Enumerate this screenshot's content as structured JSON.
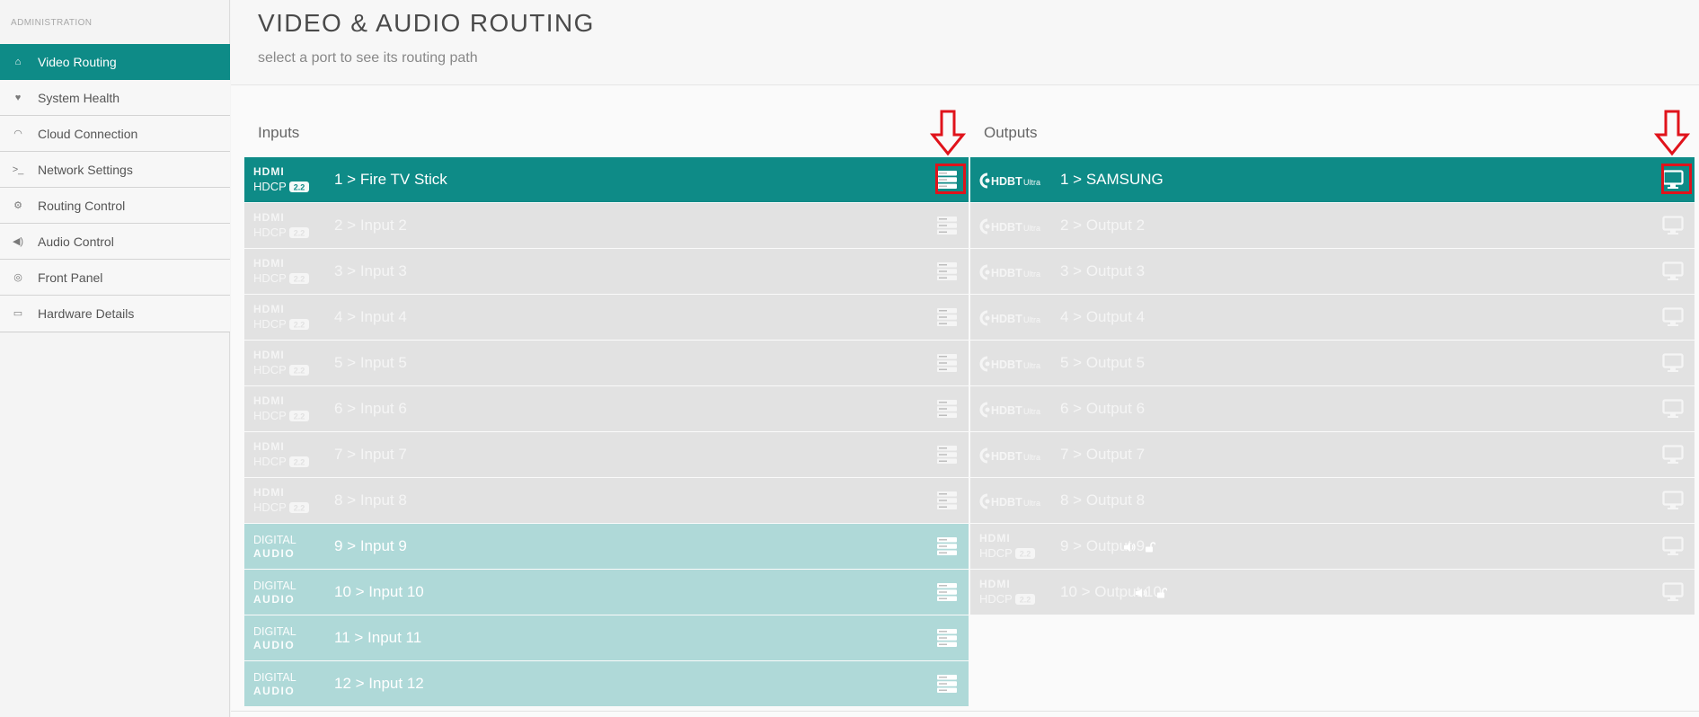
{
  "sidebar": {
    "header": "ADMINISTRATION",
    "items": [
      {
        "label": "Video Routing",
        "icon": "home-icon",
        "glyph": "⌂"
      },
      {
        "label": "System Health",
        "icon": "heart-icon",
        "glyph": "♥"
      },
      {
        "label": "Cloud Connection",
        "icon": "rss-icon",
        "glyph": "◠"
      },
      {
        "label": "Network Settings",
        "icon": "terminal-icon",
        "glyph": ">_"
      },
      {
        "label": "Routing Control",
        "icon": "gears-icon",
        "glyph": "⚙"
      },
      {
        "label": "Audio Control",
        "icon": "speaker-icon",
        "glyph": "◀)"
      },
      {
        "label": "Front Panel",
        "icon": "target-icon",
        "glyph": "◎"
      },
      {
        "label": "Hardware Details",
        "icon": "drive-icon",
        "glyph": "▭"
      }
    ]
  },
  "page": {
    "title": "VIDEO & AUDIO ROUTING",
    "subtitle": "select a port to see its routing path"
  },
  "inputs": {
    "heading": "Inputs",
    "ports": [
      {
        "label": "1 > Fire TV Stick",
        "type": "hdmi"
      },
      {
        "label": "2 > Input 2",
        "type": "hdmi"
      },
      {
        "label": "3 > Input 3",
        "type": "hdmi"
      },
      {
        "label": "4 > Input 4",
        "type": "hdmi"
      },
      {
        "label": "5 > Input 5",
        "type": "hdmi"
      },
      {
        "label": "6 > Input 6",
        "type": "hdmi"
      },
      {
        "label": "7 > Input 7",
        "type": "hdmi"
      },
      {
        "label": "8 > Input 8",
        "type": "hdmi"
      },
      {
        "label": "9 > Input 9",
        "type": "digital"
      },
      {
        "label": "10 > Input 10",
        "type": "digital"
      },
      {
        "label": "11 > Input 11",
        "type": "digital"
      },
      {
        "label": "12 > Input 12",
        "type": "digital"
      }
    ]
  },
  "outputs": {
    "heading": "Outputs",
    "ports": [
      {
        "label": "1 > SAMSUNG",
        "type": "hdbt"
      },
      {
        "label": "2 > Output 2",
        "type": "hdbt"
      },
      {
        "label": "3 > Output 3",
        "type": "hdbt"
      },
      {
        "label": "4 > Output 4",
        "type": "hdbt"
      },
      {
        "label": "5 > Output 5",
        "type": "hdbt"
      },
      {
        "label": "6 > Output 6",
        "type": "hdbt"
      },
      {
        "label": "7 > Output 7",
        "type": "hdbt"
      },
      {
        "label": "8 > Output 8",
        "type": "hdbt"
      },
      {
        "label": "9 > Output 9",
        "type": "hdmi"
      },
      {
        "label": "10 > Output 10",
        "type": "hdmi"
      }
    ]
  },
  "badges": {
    "hdmi_top": "HDMI",
    "hdmi_bottom": "HDCP",
    "hdcp_version": "2.2",
    "digital_top": "DIGITAL",
    "digital_bottom": "AUDIO",
    "hdbt_main": "HDBT",
    "hdbt_sub": "Ultra"
  },
  "colors": {
    "accent": "#0e8b87",
    "digital": "#afd9d8",
    "inactive": "#e2e2e2",
    "annotation": "#e0131b"
  }
}
